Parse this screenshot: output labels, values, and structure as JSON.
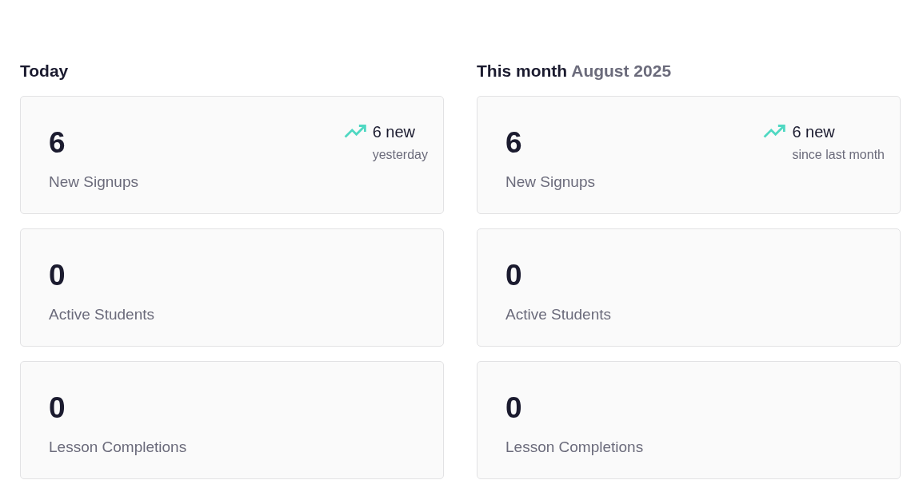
{
  "sections": [
    {
      "title": "Today",
      "stats": [
        {
          "value": "6",
          "label": "New Signups",
          "trend": {
            "rising": true,
            "change": "6 new",
            "period": "yesterday"
          }
        },
        {
          "value": "0",
          "label": "Active Students"
        },
        {
          "value": "0",
          "label": "Lesson Completions"
        }
      ]
    },
    {
      "title": "This month",
      "subtitle": "August 2025",
      "stats": [
        {
          "value": "6",
          "label": "New Signups",
          "trend": {
            "rising": true,
            "change": "6 new",
            "period": "since last month"
          }
        },
        {
          "value": "0",
          "label": "Active Students"
        },
        {
          "value": "0",
          "label": "Lesson Completions"
        }
      ]
    }
  ]
}
